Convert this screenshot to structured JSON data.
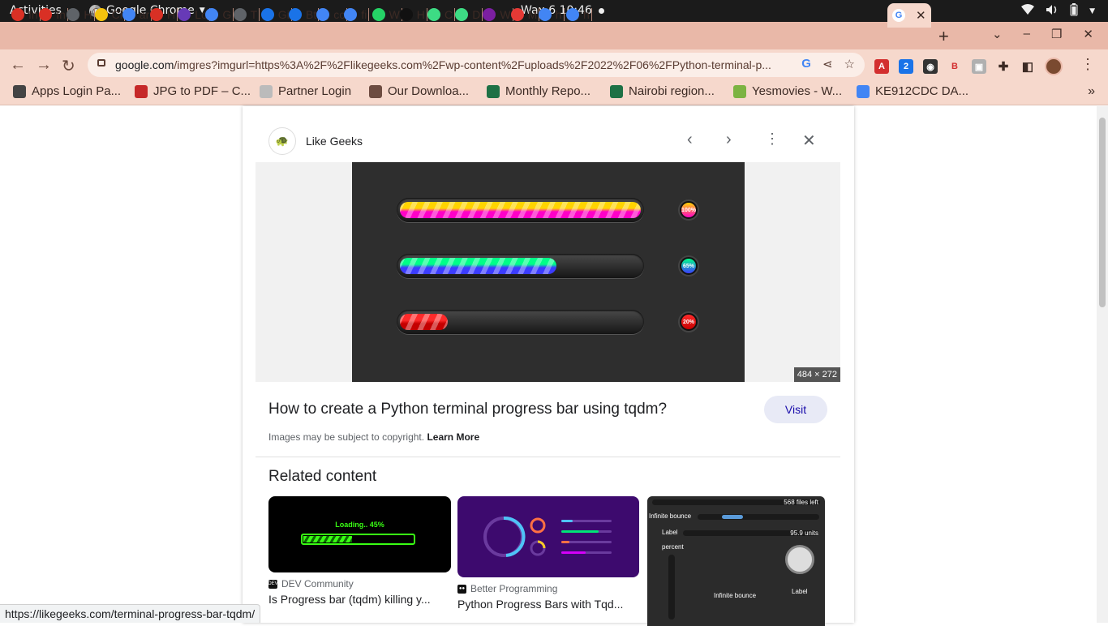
{
  "system": {
    "activities": "Activities",
    "app_name": "Google Chrome",
    "clock": "Wax 6  10:46"
  },
  "tabs": [
    {
      "label": "In",
      "icon": "gmail-icon",
      "color": "#d93025"
    },
    {
      "label": "In",
      "icon": "gmail-icon",
      "color": "#d93025"
    },
    {
      "label": "H",
      "icon": "globe-icon",
      "color": "#5f6368"
    },
    {
      "label": "Cl",
      "icon": "m-icon",
      "color": "#f4c20d"
    },
    {
      "label": "ar",
      "icon": "google-icon",
      "color": "#4285f4"
    },
    {
      "label": "H",
      "icon": "page-icon",
      "color": "#d93025"
    },
    {
      "label": "Lo",
      "icon": "k-icon",
      "color": "#673ab7"
    },
    {
      "label": "G",
      "icon": "google-icon",
      "color": "#4285f4"
    },
    {
      "label": "T",
      "icon": "globe-icon",
      "color": "#5f6368"
    },
    {
      "label": "Gi",
      "icon": "cloud-icon",
      "color": "#1a73e8"
    },
    {
      "label": "Bt",
      "icon": "cloud-icon",
      "color": "#1a73e8"
    },
    {
      "label": "cc",
      "icon": "google-icon",
      "color": "#4285f4"
    },
    {
      "label": "fi",
      "icon": "google-icon",
      "color": "#4285f4"
    },
    {
      "label": "W",
      "icon": "whatsapp-icon",
      "color": "#25d366"
    },
    {
      "label": "H",
      "icon": "q-icon",
      "color": "#111111"
    },
    {
      "label": "C",
      "icon": "android-icon",
      "color": "#3ddc84"
    },
    {
      "label": "D",
      "icon": "android-icon",
      "color": "#3ddc84"
    },
    {
      "label": "W",
      "icon": "circle-icon",
      "color": "#7b1fa2"
    },
    {
      "label": "M",
      "icon": "m-icon",
      "color": "#e53935"
    },
    {
      "label": "h",
      "icon": "google-icon",
      "color": "#4285f4"
    },
    {
      "label": "h",
      "icon": "google-icon",
      "color": "#4285f4"
    }
  ],
  "toolbar": {
    "url_host": "google.com",
    "url_path": "/imgres?imgurl=https%3A%2F%2Flikegeeks.com%2Fwp-content%2Fuploads%2F2022%2F06%2FPython-terminal-p..."
  },
  "bookmarks": [
    {
      "label": "Apps Login Pa...",
      "icon": "graduation-icon",
      "color": "#444444"
    },
    {
      "label": "JPG to PDF – C...",
      "icon": "jpgpdf-icon",
      "color": "#c62828"
    },
    {
      "label": "Partner Login",
      "icon": "feather-icon",
      "color": "#bbbbbb"
    },
    {
      "label": "Our Downloa...",
      "icon": "crest-icon",
      "color": "#6d4c41"
    },
    {
      "label": "Monthly Repo...",
      "icon": "forms-icon",
      "color": "#1e7145"
    },
    {
      "label": "Nairobi region...",
      "icon": "forms-icon",
      "color": "#1e7145"
    },
    {
      "label": "Yesmovies - W...",
      "icon": "play-icon",
      "color": "#7cb342"
    },
    {
      "label": "KE912CDC DA...",
      "icon": "google-icon",
      "color": "#4285f4"
    }
  ],
  "viewer": {
    "source_name": "Like Geeks",
    "image_dims": "484 × 272",
    "title": "How to create a Python terminal progress bar using tqdm?",
    "visit_label": "Visit",
    "copyright_text": "Images may be subject to copyright.",
    "learn_more": "Learn More",
    "related_heading": "Related content"
  },
  "preview_bars": [
    {
      "progress": 1.0,
      "knob_text": "100%",
      "colors": [
        "#ffd400",
        "#ff00c8"
      ]
    },
    {
      "progress": 0.65,
      "knob_text": "65%",
      "colors": [
        "#00ff88",
        "#3c3cff"
      ]
    },
    {
      "progress": 0.2,
      "knob_text": "20%",
      "colors": [
        "#ff2a2a",
        "#c40000"
      ]
    }
  ],
  "related": [
    {
      "source": "DEV Community",
      "title": "Is Progress bar (tqdm) killing y...",
      "thumb_text": "Loading.. 45%",
      "progress": 0.45
    },
    {
      "source": "Better Programming",
      "title": "Python Progress Bars with Tqd..."
    },
    {
      "source": "",
      "title": "",
      "thumb_texts": [
        "568 files left",
        "Infinite bounce",
        "Label",
        "95.9 units",
        "percent",
        "Infinite bounce",
        "Label"
      ]
    }
  ],
  "status_url": "https://likegeeks.com/terminal-progress-bar-tqdm/"
}
